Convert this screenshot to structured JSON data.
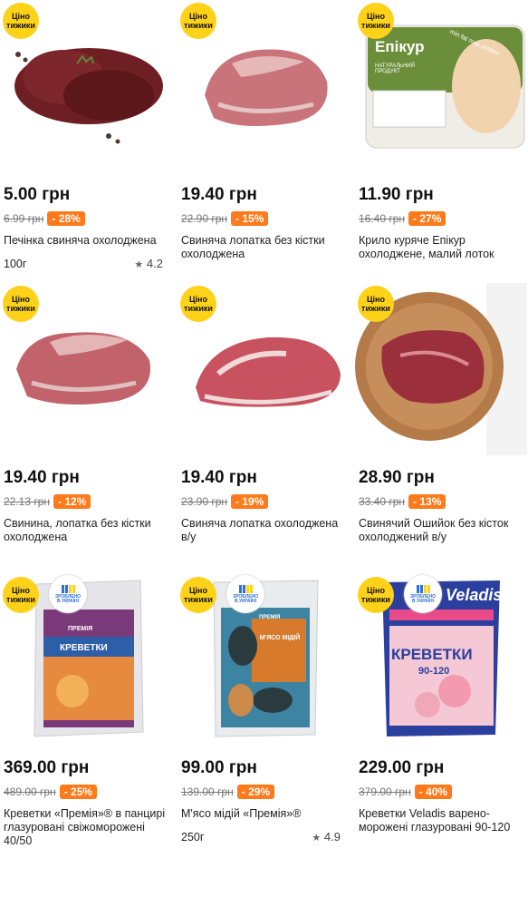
{
  "badge": {
    "line1": "Ціно",
    "line2": "тижики"
  },
  "made_in_ukraine": {
    "line1": "ЗРОБЛЕНО",
    "line2": "В УКРАЇНІ"
  },
  "products": [
    {
      "price": "5.00 грн",
      "old_price": "6.99 грн",
      "discount": "- 28%",
      "title": "Печінка свиняча охолоджена",
      "weight": "100г",
      "rating": "4.2"
    },
    {
      "price": "19.40 грн",
      "old_price": "22.90 грн",
      "discount": "- 15%",
      "title": "Свиняча лопатка без кістки охолоджена",
      "weight": "",
      "rating": ""
    },
    {
      "price": "11.90 грн",
      "old_price": "16.40 грн",
      "discount": "- 27%",
      "title": "Крило куряче Епікур охолоджене, малий лоток",
      "weight": "",
      "rating": "",
      "pack": {
        "brand": "Епікур",
        "sub": "НАТУРАЛЬНИЙ ПРОДУКТ",
        "side": "min fat max protein"
      }
    },
    {
      "price": "19.40 грн",
      "old_price": "22.13 грн",
      "discount": "- 12%",
      "title": "Свинина, лопатка без кістки охолоджена",
      "weight": "",
      "rating": ""
    },
    {
      "price": "19.40 грн",
      "old_price": "23.90 грн",
      "discount": "- 19%",
      "title": "Свиняча лопатка охолоджена в/у",
      "weight": "",
      "rating": ""
    },
    {
      "price": "28.90 грн",
      "old_price": "33.40 грн",
      "discount": "- 13%",
      "title": "Свинячий Ошийок без кісток охолоджений в/у",
      "weight": "",
      "rating": ""
    },
    {
      "price": "369.00 грн",
      "old_price": "489.00 грн",
      "discount": "- 25%",
      "title": "Креветки «Премія»® в панцирі глазуровані свіжоморожені 40/50",
      "weight": "",
      "rating": "",
      "pack": {
        "brand": "ПРЕМІЯ",
        "name": "КРЕВЕТКИ"
      }
    },
    {
      "price": "99.00 грн",
      "old_price": "139.00 грн",
      "discount": "- 29%",
      "title": "М'ясо мідій «Премія»®",
      "weight": "250г",
      "rating": "4.9",
      "pack": {
        "brand": "ПРЕМІЯ",
        "name": "М'ЯСО МІДІЙ"
      }
    },
    {
      "price": "229.00 грн",
      "old_price": "379.00 грн",
      "discount": "- 40%",
      "title": "Креветки Veladis варено-морожені глазуровані 90-120",
      "weight": "",
      "rating": "",
      "pack": {
        "brand": "Veladis",
        "name": "КРЕВЕТКИ",
        "size": "90-120"
      }
    }
  ],
  "colors": {
    "badge": "#ffd21a",
    "discount": "#ff7a1a"
  }
}
